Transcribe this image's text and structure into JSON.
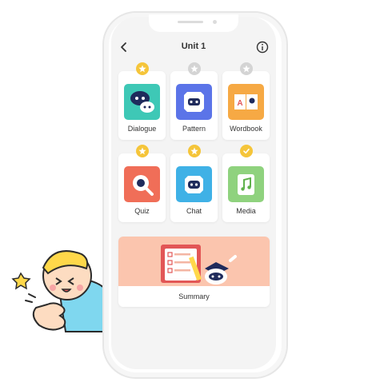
{
  "header": {
    "title": "Unit 1"
  },
  "cards": [
    {
      "label": "Dialogue",
      "badge": "star",
      "badge_state": "earned",
      "color": "#3ec8b6"
    },
    {
      "label": "Pattern",
      "badge": "star",
      "badge_state": "locked",
      "color": "#5b74e8"
    },
    {
      "label": "Wordbook",
      "badge": "star",
      "badge_state": "locked",
      "color": "#f6a944"
    },
    {
      "label": "Quiz",
      "badge": "star",
      "badge_state": "partial",
      "color": "#f06e58"
    },
    {
      "label": "Chat",
      "badge": "star",
      "badge_state": "earned",
      "color": "#3fb1e6"
    },
    {
      "label": "Media",
      "badge": "check",
      "badge_state": "done",
      "color": "#8fd27e"
    }
  ],
  "summary": {
    "label": "Summary",
    "color": "#fbc5ae"
  },
  "colors": {
    "gold": "#f5c53a",
    "grey": "#d4d4d4",
    "screen_bg": "#f4f4f4"
  },
  "icons": [
    "back-arrow-icon",
    "info-icon",
    "star-icon",
    "check-icon"
  ]
}
